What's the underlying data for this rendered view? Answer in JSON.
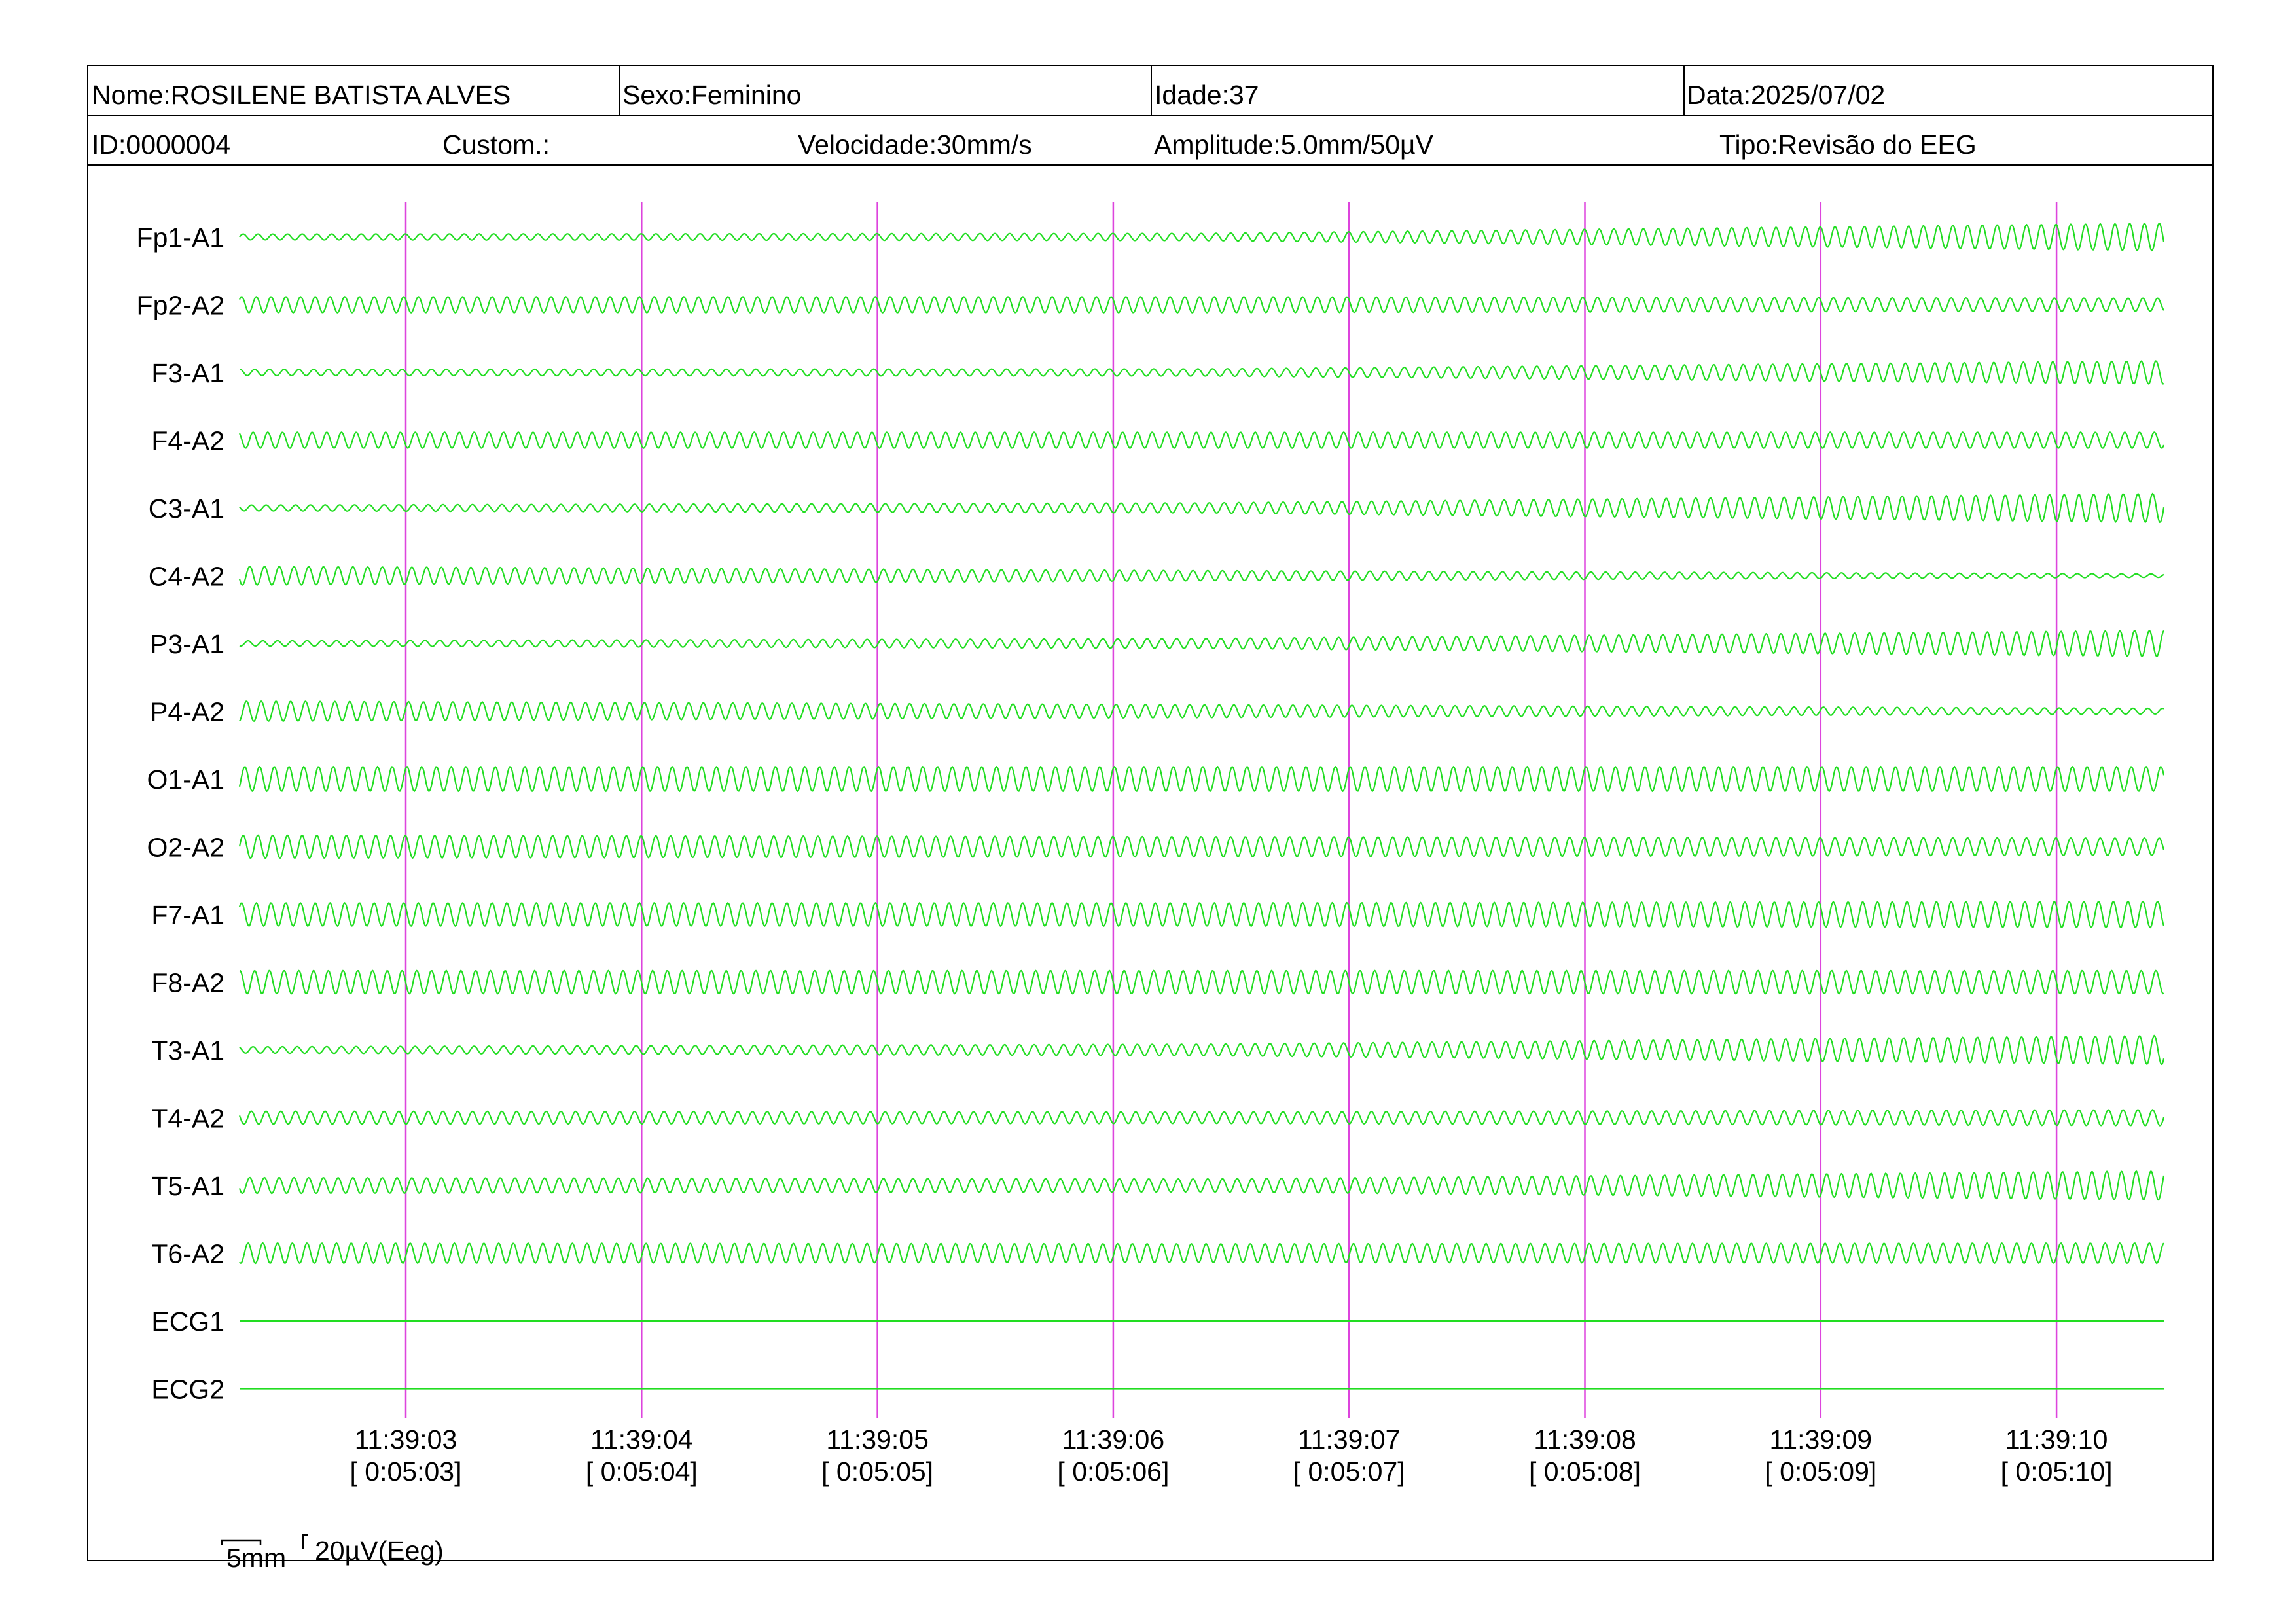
{
  "header": {
    "nome": "Nome:ROSILENE BATISTA ALVES",
    "sexo": "Sexo:Feminino",
    "idade": "Idade:37",
    "data": "Data:2025/07/02",
    "id": "ID:0000004",
    "custom": "Custom.:",
    "velocidade": "Velocidade:30mm/s",
    "amplitude": "Amplitude:5.0mm/50µV",
    "tipo": "Tipo:Revisão do EEG"
  },
  "scale": {
    "time_label": "5mm",
    "amp_label": "20µV(Eeg)"
  },
  "colors": {
    "trace": "#22dd22",
    "marker": "#dd44dd",
    "border": "#000000"
  },
  "chart_data": {
    "type": "line",
    "channels": [
      "Fp1-A1",
      "Fp2-A2",
      "F3-A1",
      "F4-A2",
      "C3-A1",
      "C4-A2",
      "P3-A1",
      "P4-A2",
      "O1-A1",
      "O2-A2",
      "F7-A1",
      "F8-A2",
      "T3-A1",
      "T4-A2",
      "T5-A1",
      "T6-A2",
      "ECG1",
      "ECG2"
    ],
    "amplitude_profile": [
      [
        0.2,
        0.25,
        0.95
      ],
      [
        0.55,
        0.55,
        0.45
      ],
      [
        0.22,
        0.25,
        0.8
      ],
      [
        0.55,
        0.55,
        0.55
      ],
      [
        0.2,
        0.35,
        1.0
      ],
      [
        0.65,
        0.35,
        0.12
      ],
      [
        0.18,
        0.35,
        0.9
      ],
      [
        0.7,
        0.45,
        0.2
      ],
      [
        0.85,
        0.85,
        0.85
      ],
      [
        0.8,
        0.7,
        0.6
      ],
      [
        0.8,
        0.8,
        0.9
      ],
      [
        0.8,
        0.8,
        0.8
      ],
      [
        0.22,
        0.4,
        1.0
      ],
      [
        0.45,
        0.4,
        0.55
      ],
      [
        0.55,
        0.45,
        1.0
      ],
      [
        0.7,
        0.65,
        0.7
      ],
      [
        0,
        0,
        0
      ],
      [
        0,
        0,
        0
      ]
    ],
    "cycles_per_second": 16,
    "time_markers": [
      {
        "time": "11:39:03",
        "elapsed": "[ 0:05:03]"
      },
      {
        "time": "11:39:04",
        "elapsed": "[ 0:05:04]"
      },
      {
        "time": "11:39:05",
        "elapsed": "[ 0:05:05]"
      },
      {
        "time": "11:39:06",
        "elapsed": "[ 0:05:06]"
      },
      {
        "time": "11:39:07",
        "elapsed": "[ 0:05:07]"
      },
      {
        "time": "11:39:08",
        "elapsed": "[ 0:05:08]"
      },
      {
        "time": "11:39:09",
        "elapsed": "[ 0:05:09]"
      },
      {
        "time": "11:39:10",
        "elapsed": "[ 0:05:10]"
      }
    ],
    "time_range_seconds": [
      0,
      8.16
    ]
  }
}
